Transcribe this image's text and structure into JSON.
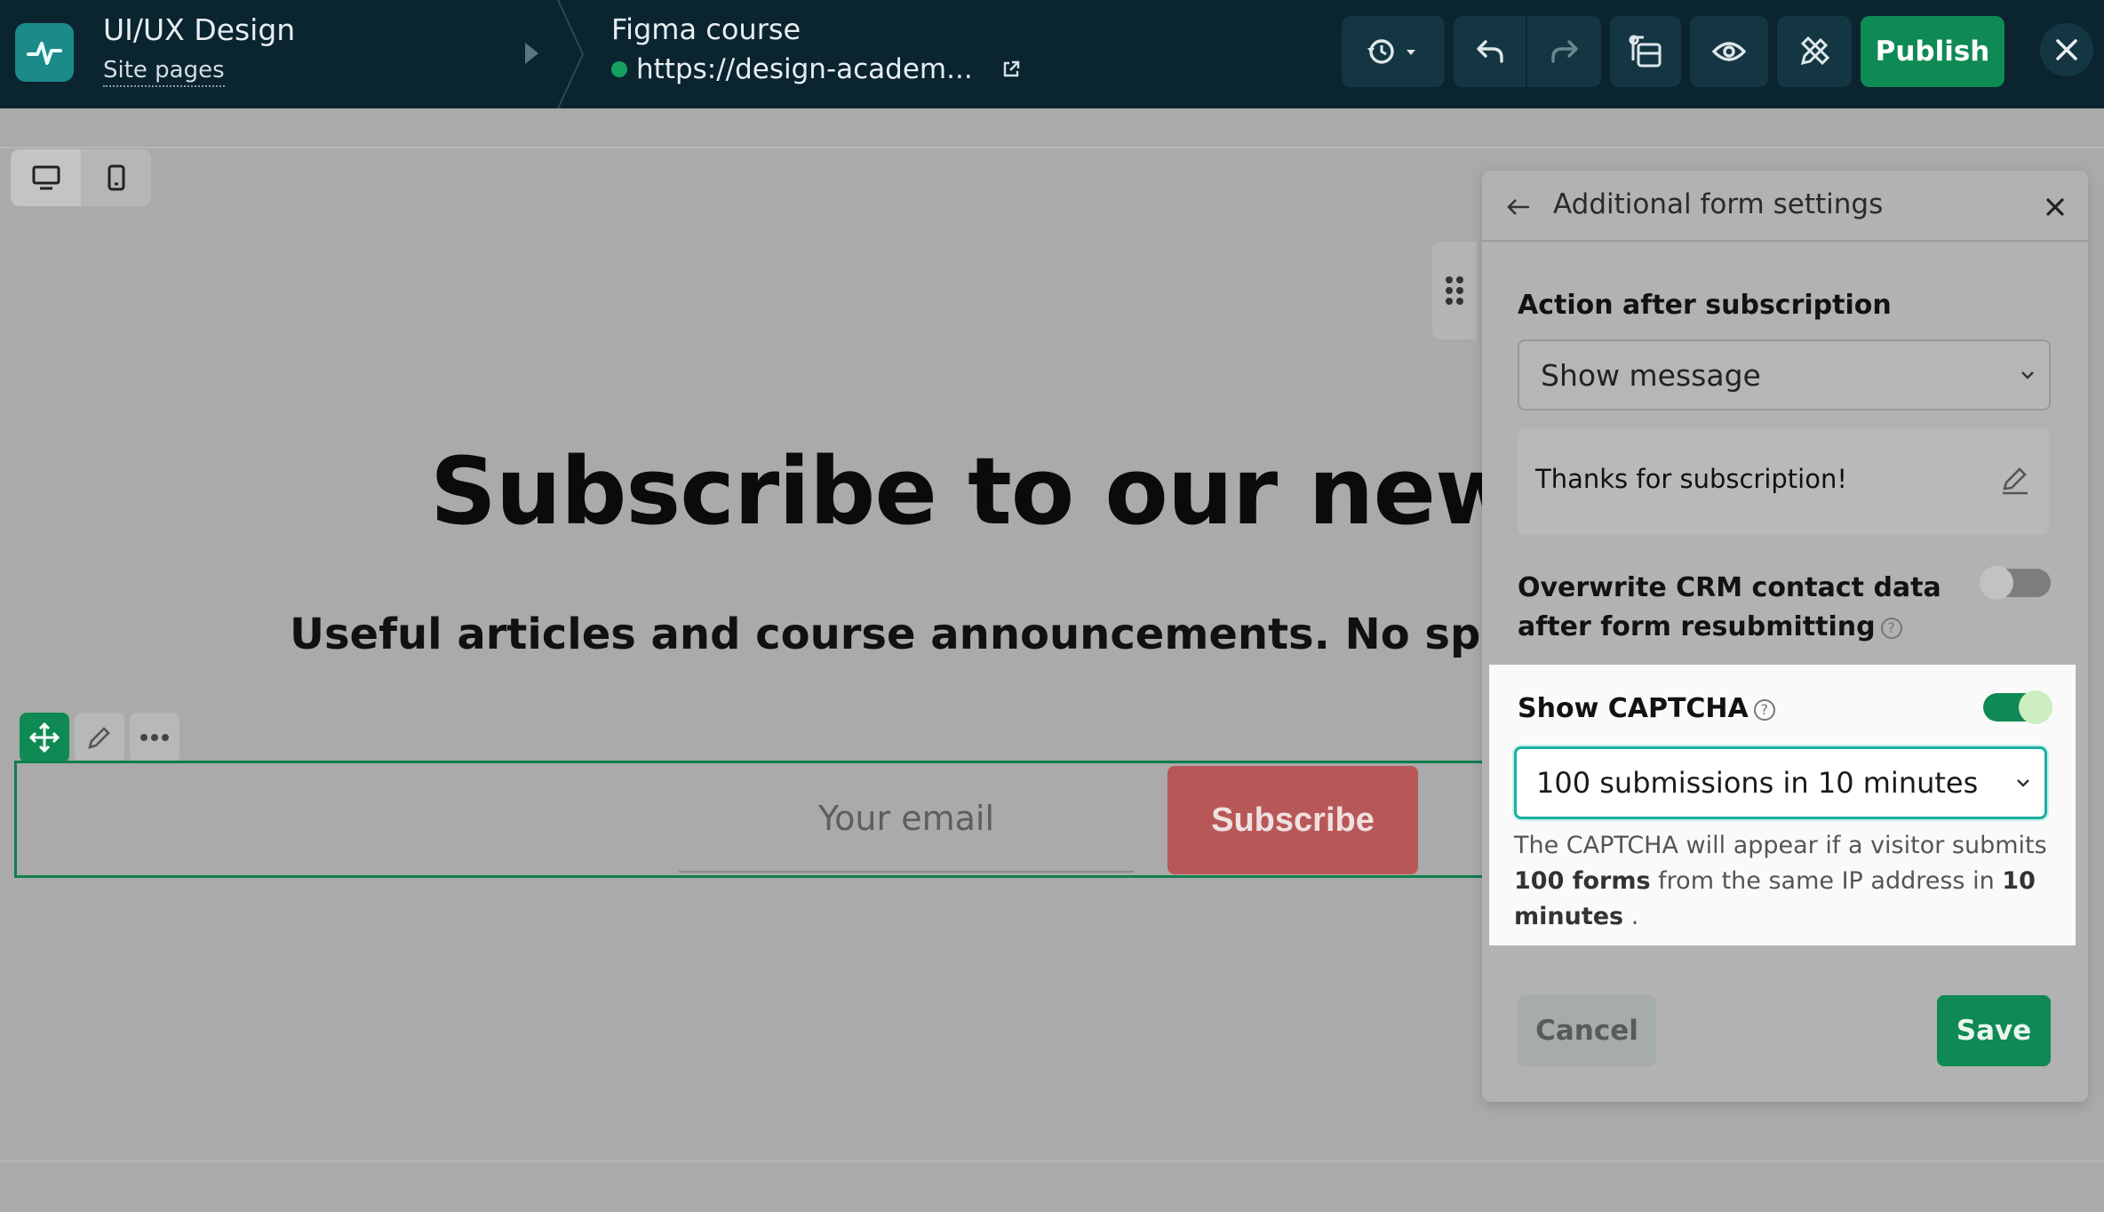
{
  "topbar": {
    "project_title": "UI/UX Design",
    "project_sub": "Site pages",
    "page_title": "Figma course",
    "page_url": "https://design-academ...",
    "publish_label": "Publish"
  },
  "canvas": {
    "headline": "Subscribe to our newsle",
    "subline": "Useful articles and course announcements. No spam — you",
    "email_placeholder": "Your email",
    "subscribe_label": "Subscribe"
  },
  "panel": {
    "title": "Additional form settings",
    "action_label": "Action after subscription",
    "action_value": "Show message",
    "message_text": "Thanks for subscription!",
    "overwrite_line1": "Overwrite CRM contact data",
    "overwrite_line2": "after form resubmitting",
    "overwrite_enabled": false,
    "captcha_label": "Show CAPTCHA",
    "captcha_enabled": true,
    "captcha_value": "100 submissions in 10 minutes",
    "captcha_desc_1": "The CAPTCHA will appear if a visitor submits",
    "captcha_desc_bold1": "100 forms",
    "captcha_desc_2": "from the same IP address in",
    "captcha_desc_bold2": "10 minutes",
    "captcha_desc_3": ".",
    "help_glyph": "?",
    "cancel_label": "Cancel",
    "save_label": "Save"
  },
  "colors": {
    "topbar": "#0a2430",
    "accent_green": "#0f8a54",
    "subscribe_red": "#b85758",
    "focus_teal": "#1ab0a0"
  }
}
